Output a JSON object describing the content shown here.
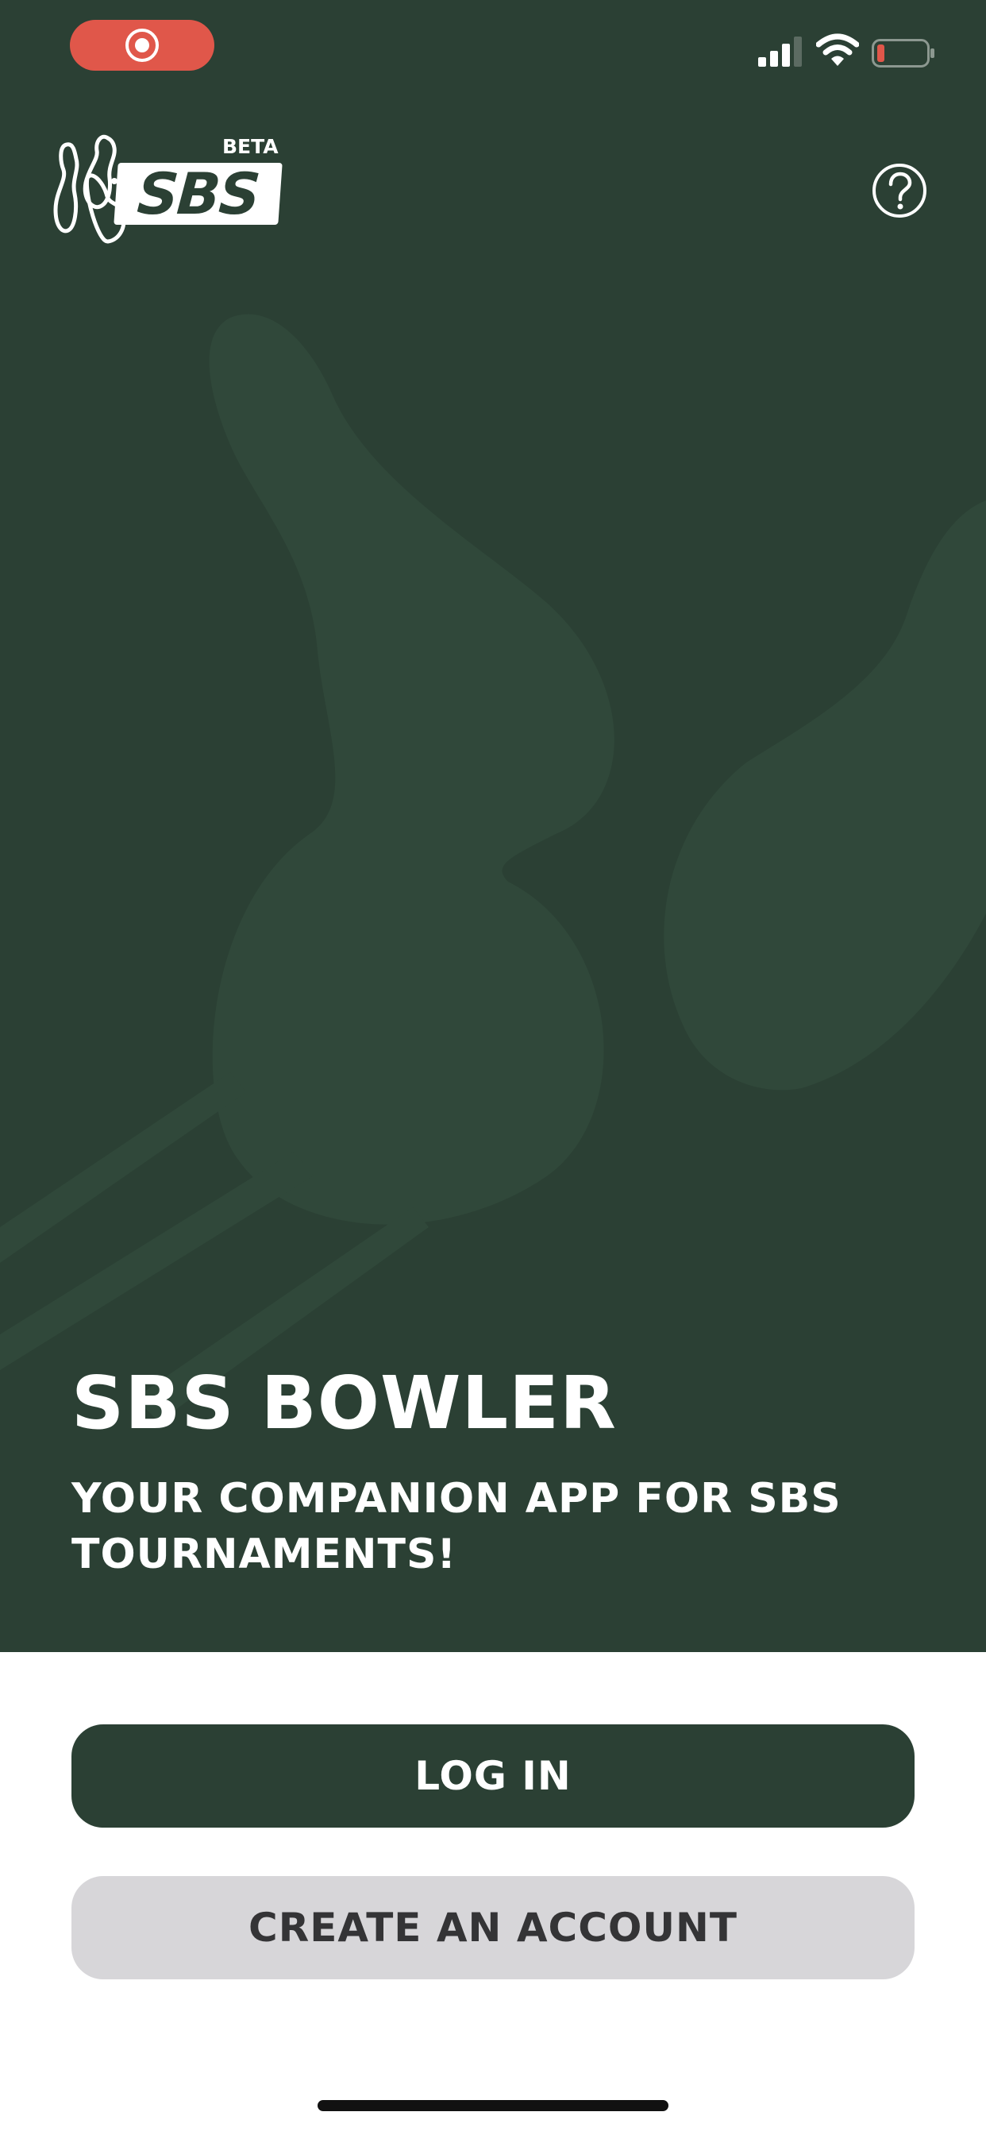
{
  "status_bar": {
    "recording_icon": "screen-record-icon",
    "signal_icon": "cellular-signal-icon",
    "wifi_icon": "wifi-icon",
    "battery_icon": "battery-low-icon"
  },
  "header": {
    "logo_text": "SBS",
    "logo_badge": "BETA",
    "help_icon": "question-circle-icon"
  },
  "hero": {
    "title": "SBS BOWLER",
    "subtitle": "YOUR COMPANION APP FOR SBS TOURNAMENTS!",
    "background_art": "bowling-pins-illustration"
  },
  "actions": {
    "login_label": "LOG IN",
    "create_account_label": "CREATE AN ACCOUNT"
  },
  "colors": {
    "brand_green": "#2b4034",
    "record_red": "#e0574a",
    "secondary_button": "#d7d6d9"
  }
}
